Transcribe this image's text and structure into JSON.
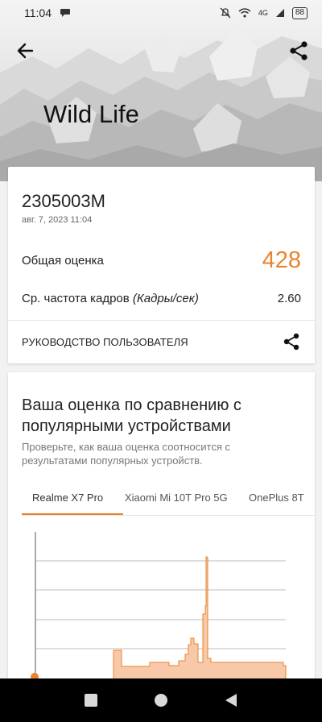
{
  "status_bar": {
    "time": "11:04",
    "network": "4G",
    "battery": "88"
  },
  "header": {
    "title": "Wild Life"
  },
  "result": {
    "device": "2305003M",
    "date": "авг. 7, 2023 11:04",
    "score_label": "Общая оценка",
    "score": "428",
    "fps_label_prefix": "Ср. частота кадров ",
    "fps_label_unit": "(Кадры/сек)",
    "fps": "2.60",
    "guide_label": "РУКОВОДСТВО ПОЛЬЗОВАТЕЛЯ"
  },
  "comparison": {
    "title": "Ваша оценка по сравнению с популярными устройствами",
    "description": "Проверьте, как ваша оценка соотносится с результатами популярных устройств.",
    "tabs": [
      {
        "label": "Realme X7 Pro",
        "active": true
      },
      {
        "label": "Xiaomi Mi 10T Pro 5G",
        "active": false
      },
      {
        "label": "OnePlus 8T",
        "active": false
      }
    ]
  },
  "colors": {
    "accent": "#e8842d",
    "chart_fill": "#f8c9a8"
  },
  "icons": [
    "back-arrow-icon",
    "share-icon",
    "square-icon",
    "circle-icon",
    "triangle-back-icon",
    "chat-bubble-icon",
    "mute-icon",
    "wifi-icon",
    "signal-icon",
    "battery-icon"
  ]
}
